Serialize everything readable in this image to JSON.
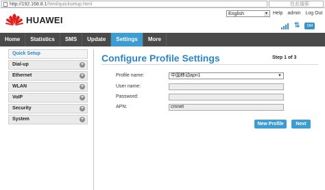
{
  "browser": {
    "url_main": "http://192.168.8.1",
    "url_rest": "/html/quicksetup.html",
    "search_placeholder": "在此搜索"
  },
  "header": {
    "brand": "HUAWEI",
    "language": "English",
    "help": "Help",
    "user": "admin",
    "logout": "Log Out",
    "sim_label": "SIM"
  },
  "nav": {
    "tabs": [
      {
        "label": "Home"
      },
      {
        "label": "Statistics"
      },
      {
        "label": "SMS"
      },
      {
        "label": "Update"
      },
      {
        "label": "Settings"
      },
      {
        "label": "More"
      }
    ],
    "active": "Settings"
  },
  "sidebar": {
    "items": [
      {
        "label": "Quick Setup"
      },
      {
        "label": "Dial-up"
      },
      {
        "label": "Ethernet"
      },
      {
        "label": "WLAN"
      },
      {
        "label": "VoIP"
      },
      {
        "label": "Security"
      },
      {
        "label": "System"
      }
    ]
  },
  "main": {
    "title": "Configure Profile Settings",
    "step": "Step 1 of 3",
    "form": {
      "profile_name_label": "Profile name:",
      "profile_name_value": "中国移动apn1",
      "username_label": "User name:",
      "username_value": "",
      "password_label": "Password:",
      "password_value": "",
      "apn_label": "APN:",
      "apn_value": "cmnet"
    },
    "new_profile_button": "New Profile",
    "next_button": "Next"
  },
  "colors": {
    "accent": "#3d9cd2",
    "nav_bg": "#4a4a4a",
    "title": "#2a85c6",
    "logo_red": "#e0201b"
  }
}
